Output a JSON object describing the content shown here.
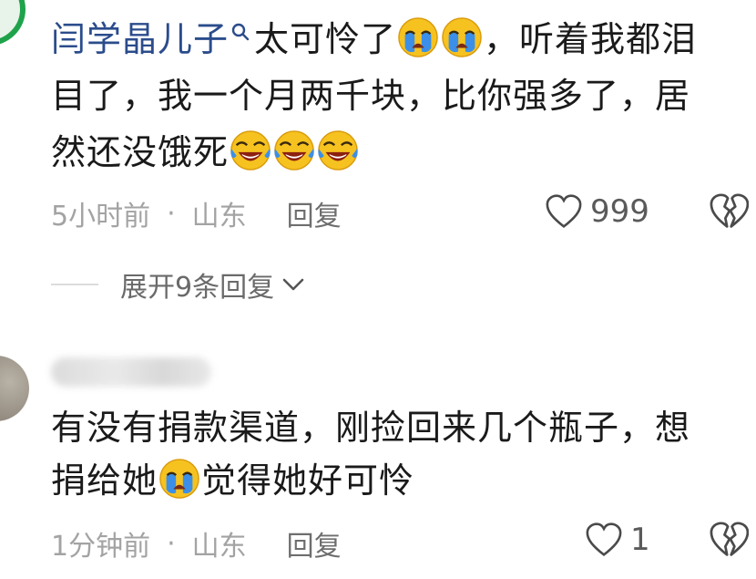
{
  "comment1": {
    "username": "闫学晶儿子",
    "text_line1_a": "太可怜了",
    "text_line1_b": "，听着我都泪",
    "text_line2": "目了，我一个月两千块，比你强多了，居",
    "text_line3": "然还没饿死",
    "time": "5小时前",
    "location": "山东",
    "reply_label": "回复",
    "likes": "999",
    "expand_label": "展开9条回复"
  },
  "comment2": {
    "text_line1": "有没有捐款渠道，刚捡回来几个瓶子，想",
    "text_line2_a": "捐给她",
    "text_line2_b": "觉得她好可怜",
    "time": "1分钟前",
    "location": "山东",
    "reply_label": "回复",
    "likes": "1"
  },
  "separator": "·",
  "colors": {
    "username": "#2b4c8c",
    "meta_gray": "#a3a3a3",
    "emoji_yellow": "#f6c21f",
    "tear_blue": "#3b8fe8",
    "avatar_ring_green": "#1fa34a"
  },
  "icons": [
    "search-icon",
    "crying-emoji-icon",
    "laughing-tears-emoji-icon",
    "heart-icon",
    "broken-heart-icon",
    "chevron-down-icon"
  ]
}
